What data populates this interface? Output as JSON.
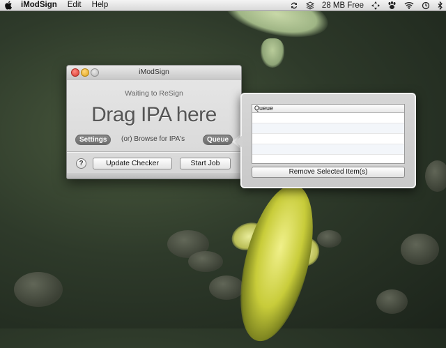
{
  "menubar": {
    "app_name": "iModSign",
    "menus": [
      "Edit",
      "Help"
    ],
    "memory_free": "28 MB Free",
    "status_icons": [
      "sync-icon",
      "layers-icon",
      "memory-icon",
      "move-icon",
      "paw-icon",
      "wifi-icon",
      "time-machine-icon",
      "bluetooth-icon"
    ]
  },
  "window": {
    "title": "iModSign",
    "status": "Waiting to ReSign",
    "drop_target": "Drag IPA here",
    "settings_label": "Settings",
    "browse_label": "(or) Browse for IPA's",
    "queue_label": "Queue",
    "help_label": "?",
    "update_label": "Update Checker",
    "start_label": "Start Job"
  },
  "popover": {
    "column_header": "Queue",
    "rows": [
      "",
      "",
      "",
      "",
      ""
    ],
    "remove_label": "Remove Selected Item(s)"
  }
}
